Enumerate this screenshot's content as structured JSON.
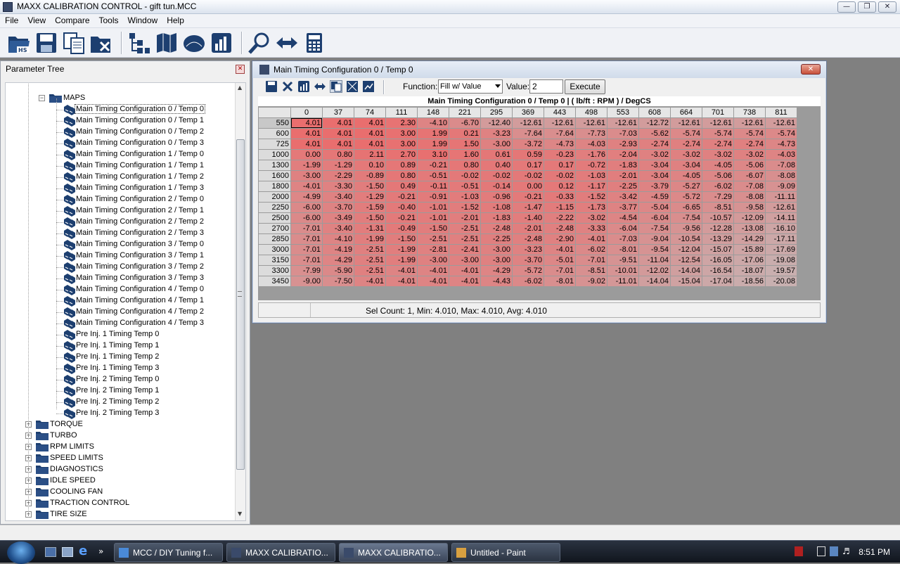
{
  "window": {
    "title": "MAXX CALIBRATION CONTROL - gift tun.MCC"
  },
  "menu": [
    "File",
    "View",
    "Compare",
    "Tools",
    "Window",
    "Help"
  ],
  "toolbar_icons": [
    "open-hs-icon",
    "save-icon",
    "copy-icon",
    "close-file-icon",
    "tree-icon",
    "map-book-icon",
    "gauge-icon",
    "chart-icon",
    "search-icon",
    "compare-arrows-icon",
    "calculator-icon"
  ],
  "parameter_tree": {
    "title": "Parameter Tree",
    "maps_folder": "MAPS",
    "map_items": [
      "Main Timing Configuration 0 / Temp 0",
      "Main Timing Configuration 0 / Temp 1",
      "Main Timing Configuration 0 / Temp 2",
      "Main Timing Configuration 0 / Temp 3",
      "Main Timing Configuration 1 / Temp 0",
      "Main Timing Configuration 1 / Temp 1",
      "Main Timing Configuration 1 / Temp 2",
      "Main Timing Configuration 1 / Temp 3",
      "Main Timing Configuration 2 / Temp 0",
      "Main Timing Configuration 2 / Temp 1",
      "Main Timing Configuration 2 / Temp 2",
      "Main Timing Configuration 2 / Temp 3",
      "Main Timing Configuration 3 / Temp 0",
      "Main Timing Configuration 3 / Temp 1",
      "Main Timing Configuration 3 / Temp 2",
      "Main Timing Configuration 3 / Temp 3",
      "Main Timing Configuration 4 / Temp 0",
      "Main Timing Configuration 4 / Temp 1",
      "Main Timing Configuration 4 / Temp 2",
      "Main Timing Configuration 4 / Temp 3",
      "Pre Inj. 1 Timing Temp 0",
      "Pre Inj. 1 Timing Temp 1",
      "Pre Inj. 1 Timing Temp 2",
      "Pre Inj. 1 Timing Temp 3",
      "Pre Inj. 2 Timing Temp 0",
      "Pre Inj. 2 Timing Temp 1",
      "Pre Inj. 2 Timing Temp 2",
      "Pre Inj. 2 Timing Temp 3"
    ],
    "selected_index": 0,
    "folders": [
      "TORQUE",
      "TURBO",
      "RPM LIMITS",
      "SPEED LIMITS",
      "DIAGNOSTICS",
      "IDLE SPEED",
      "COOLING FAN",
      "TRACTION CONTROL",
      "TIRE SIZE"
    ]
  },
  "map_window": {
    "title": "Main Timing Configuration 0 / Temp 0",
    "function_label": "Function:",
    "function_value": "Fill w/ Value",
    "value_label": "Value:",
    "value": "2",
    "execute_label": "Execute",
    "table_title": "Main Timing Configuration 0 / Temp 0 |  ( lb/ft : RPM ) / DegCS",
    "columns": [
      "0",
      "37",
      "74",
      "111",
      "148",
      "221",
      "295",
      "369",
      "443",
      "498",
      "553",
      "608",
      "664",
      "701",
      "738",
      "811"
    ],
    "rows": [
      {
        "rpm": "550",
        "v": [
          "4.01",
          "4.01",
          "4.01",
          "2.30",
          "-4.10",
          "-6.70",
          "-12.40",
          "-12.61",
          "-12.61",
          "-12.61",
          "-12.61",
          "-12.72",
          "-12.61",
          "-12.61",
          "-12.61",
          "-12.61"
        ]
      },
      {
        "rpm": "600",
        "v": [
          "4.01",
          "4.01",
          "4.01",
          "3.00",
          "1.99",
          "0.21",
          "-3.23",
          "-7.64",
          "-7.64",
          "-7.73",
          "-7.03",
          "-5.62",
          "-5.74",
          "-5.74",
          "-5.74",
          "-5.74"
        ]
      },
      {
        "rpm": "725",
        "v": [
          "4.01",
          "4.01",
          "4.01",
          "3.00",
          "1.99",
          "1.50",
          "-3.00",
          "-3.72",
          "-4.73",
          "-4.03",
          "-2.93",
          "-2.74",
          "-2.74",
          "-2.74",
          "-2.74",
          "-4.73"
        ]
      },
      {
        "rpm": "1000",
        "v": [
          "0.00",
          "0.80",
          "2.11",
          "2.70",
          "3.10",
          "1.60",
          "0.61",
          "0.59",
          "-0.23",
          "-1.76",
          "-2.04",
          "-3.02",
          "-3.02",
          "-3.02",
          "-3.02",
          "-4.03"
        ]
      },
      {
        "rpm": "1300",
        "v": [
          "-1.99",
          "-1.29",
          "0.10",
          "0.89",
          "-0.21",
          "0.80",
          "0.40",
          "0.17",
          "0.17",
          "-0.72",
          "-1.83",
          "-3.04",
          "-3.04",
          "-4.05",
          "-5.06",
          "-7.08"
        ]
      },
      {
        "rpm": "1600",
        "v": [
          "-3.00",
          "-2.29",
          "-0.89",
          "0.80",
          "-0.51",
          "-0.02",
          "-0.02",
          "-0.02",
          "-0.02",
          "-1.03",
          "-2.01",
          "-3.04",
          "-4.05",
          "-5.06",
          "-6.07",
          "-8.08"
        ]
      },
      {
        "rpm": "1800",
        "v": [
          "-4.01",
          "-3.30",
          "-1.50",
          "0.49",
          "-0.11",
          "-0.51",
          "-0.14",
          "0.00",
          "0.12",
          "-1.17",
          "-2.25",
          "-3.79",
          "-5.27",
          "-6.02",
          "-7.08",
          "-9.09"
        ]
      },
      {
        "rpm": "2000",
        "v": [
          "-4.99",
          "-3.40",
          "-1.29",
          "-0.21",
          "-0.91",
          "-1.03",
          "-0.96",
          "-0.21",
          "-0.33",
          "-1.52",
          "-3.42",
          "-4.59",
          "-5.72",
          "-7.29",
          "-8.08",
          "-11.11"
        ]
      },
      {
        "rpm": "2250",
        "v": [
          "-6.00",
          "-3.70",
          "-1.59",
          "-0.40",
          "-1.01",
          "-1.52",
          "-1.08",
          "-1.47",
          "-1.15",
          "-1.73",
          "-3.77",
          "-5.04",
          "-6.65",
          "-8.51",
          "-9.58",
          "-12.61"
        ]
      },
      {
        "rpm": "2500",
        "v": [
          "-6.00",
          "-3.49",
          "-1.50",
          "-0.21",
          "-1.01",
          "-2.01",
          "-1.83",
          "-1.40",
          "-2.22",
          "-3.02",
          "-4.54",
          "-6.04",
          "-7.54",
          "-10.57",
          "-12.09",
          "-14.11"
        ]
      },
      {
        "rpm": "2700",
        "v": [
          "-7.01",
          "-3.40",
          "-1.31",
          "-0.49",
          "-1.50",
          "-2.51",
          "-2.48",
          "-2.01",
          "-2.48",
          "-3.33",
          "-6.04",
          "-7.54",
          "-9.56",
          "-12.28",
          "-13.08",
          "-16.10"
        ]
      },
      {
        "rpm": "2850",
        "v": [
          "-7.01",
          "-4.10",
          "-1.99",
          "-1.50",
          "-2.51",
          "-2.51",
          "-2.25",
          "-2.48",
          "-2.90",
          "-4.01",
          "-7.03",
          "-9.04",
          "-10.54",
          "-13.29",
          "-14.29",
          "-17.11"
        ]
      },
      {
        "rpm": "3000",
        "v": [
          "-7.01",
          "-4.19",
          "-2.51",
          "-1.99",
          "-2.81",
          "-2.41",
          "-3.00",
          "-3.23",
          "-4.01",
          "-6.02",
          "-8.01",
          "-9.54",
          "-12.04",
          "-15.07",
          "-15.89",
          "-17.69"
        ]
      },
      {
        "rpm": "3150",
        "v": [
          "-7.01",
          "-4.29",
          "-2.51",
          "-1.99",
          "-3.00",
          "-3.00",
          "-3.00",
          "-3.70",
          "-5.01",
          "-7.01",
          "-9.51",
          "-11.04",
          "-12.54",
          "-16.05",
          "-17.06",
          "-19.08"
        ]
      },
      {
        "rpm": "3300",
        "v": [
          "-7.99",
          "-5.90",
          "-2.51",
          "-4.01",
          "-4.01",
          "-4.01",
          "-4.29",
          "-5.72",
          "-7.01",
          "-8.51",
          "-10.01",
          "-12.02",
          "-14.04",
          "-16.54",
          "-18.07",
          "-19.57"
        ]
      },
      {
        "rpm": "3450",
        "v": [
          "-9.00",
          "-7.50",
          "-4.01",
          "-4.01",
          "-4.01",
          "-4.01",
          "-4.43",
          "-6.02",
          "-8.01",
          "-9.02",
          "-11.01",
          "-14.04",
          "-15.04",
          "-17.04",
          "-18.56",
          "-20.08"
        ]
      }
    ],
    "status": "Sel Count: 1, Min: 4.010, Max: 4.010, Avg: 4.010"
  },
  "colors": {
    "cell_high": "#e97a7a",
    "cell_low": "#c8b8b8",
    "selected_row_header": "#c8c8c8"
  },
  "taskbar": {
    "tasks": [
      {
        "label": "MCC / DIY Tuning f...",
        "icon": "ie-icon",
        "active": false
      },
      {
        "label": "MAXX CALIBRATIO...",
        "icon": "maxx-icon",
        "active": false
      },
      {
        "label": "MAXX CALIBRATIO...",
        "icon": "maxx-icon",
        "active": true
      },
      {
        "label": "Untitled - Paint",
        "icon": "paint-icon",
        "active": false
      }
    ],
    "clock": "8:51 PM"
  }
}
